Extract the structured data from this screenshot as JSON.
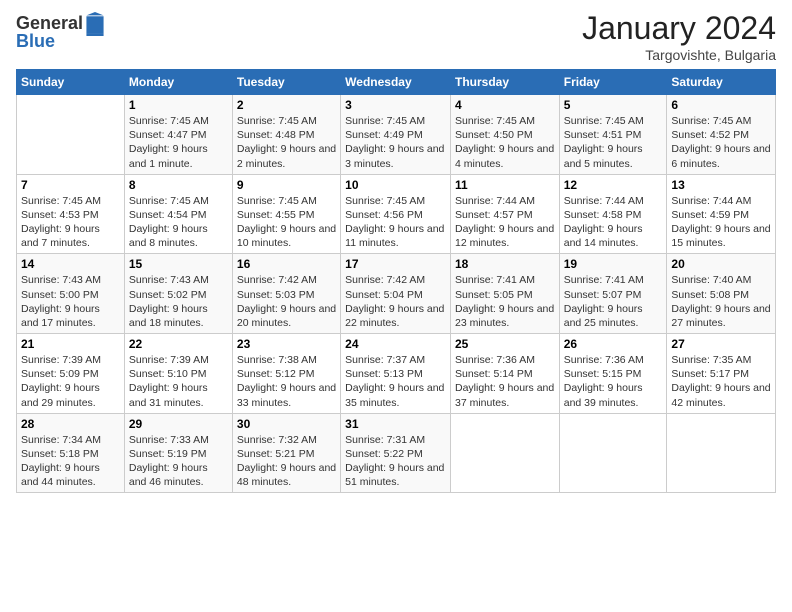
{
  "logo": {
    "general": "General",
    "blue": "Blue"
  },
  "header": {
    "title": "January 2024",
    "subtitle": "Targovishte, Bulgaria"
  },
  "days_of_week": [
    "Sunday",
    "Monday",
    "Tuesday",
    "Wednesday",
    "Thursday",
    "Friday",
    "Saturday"
  ],
  "weeks": [
    [
      {
        "day": "",
        "sunrise": "",
        "sunset": "",
        "daylight": ""
      },
      {
        "day": "1",
        "sunrise": "Sunrise: 7:45 AM",
        "sunset": "Sunset: 4:47 PM",
        "daylight": "Daylight: 9 hours and 1 minute."
      },
      {
        "day": "2",
        "sunrise": "Sunrise: 7:45 AM",
        "sunset": "Sunset: 4:48 PM",
        "daylight": "Daylight: 9 hours and 2 minutes."
      },
      {
        "day": "3",
        "sunrise": "Sunrise: 7:45 AM",
        "sunset": "Sunset: 4:49 PM",
        "daylight": "Daylight: 9 hours and 3 minutes."
      },
      {
        "day": "4",
        "sunrise": "Sunrise: 7:45 AM",
        "sunset": "Sunset: 4:50 PM",
        "daylight": "Daylight: 9 hours and 4 minutes."
      },
      {
        "day": "5",
        "sunrise": "Sunrise: 7:45 AM",
        "sunset": "Sunset: 4:51 PM",
        "daylight": "Daylight: 9 hours and 5 minutes."
      },
      {
        "day": "6",
        "sunrise": "Sunrise: 7:45 AM",
        "sunset": "Sunset: 4:52 PM",
        "daylight": "Daylight: 9 hours and 6 minutes."
      }
    ],
    [
      {
        "day": "7",
        "sunrise": "Sunrise: 7:45 AM",
        "sunset": "Sunset: 4:53 PM",
        "daylight": "Daylight: 9 hours and 7 minutes."
      },
      {
        "day": "8",
        "sunrise": "Sunrise: 7:45 AM",
        "sunset": "Sunset: 4:54 PM",
        "daylight": "Daylight: 9 hours and 8 minutes."
      },
      {
        "day": "9",
        "sunrise": "Sunrise: 7:45 AM",
        "sunset": "Sunset: 4:55 PM",
        "daylight": "Daylight: 9 hours and 10 minutes."
      },
      {
        "day": "10",
        "sunrise": "Sunrise: 7:45 AM",
        "sunset": "Sunset: 4:56 PM",
        "daylight": "Daylight: 9 hours and 11 minutes."
      },
      {
        "day": "11",
        "sunrise": "Sunrise: 7:44 AM",
        "sunset": "Sunset: 4:57 PM",
        "daylight": "Daylight: 9 hours and 12 minutes."
      },
      {
        "day": "12",
        "sunrise": "Sunrise: 7:44 AM",
        "sunset": "Sunset: 4:58 PM",
        "daylight": "Daylight: 9 hours and 14 minutes."
      },
      {
        "day": "13",
        "sunrise": "Sunrise: 7:44 AM",
        "sunset": "Sunset: 4:59 PM",
        "daylight": "Daylight: 9 hours and 15 minutes."
      }
    ],
    [
      {
        "day": "14",
        "sunrise": "Sunrise: 7:43 AM",
        "sunset": "Sunset: 5:00 PM",
        "daylight": "Daylight: 9 hours and 17 minutes."
      },
      {
        "day": "15",
        "sunrise": "Sunrise: 7:43 AM",
        "sunset": "Sunset: 5:02 PM",
        "daylight": "Daylight: 9 hours and 18 minutes."
      },
      {
        "day": "16",
        "sunrise": "Sunrise: 7:42 AM",
        "sunset": "Sunset: 5:03 PM",
        "daylight": "Daylight: 9 hours and 20 minutes."
      },
      {
        "day": "17",
        "sunrise": "Sunrise: 7:42 AM",
        "sunset": "Sunset: 5:04 PM",
        "daylight": "Daylight: 9 hours and 22 minutes."
      },
      {
        "day": "18",
        "sunrise": "Sunrise: 7:41 AM",
        "sunset": "Sunset: 5:05 PM",
        "daylight": "Daylight: 9 hours and 23 minutes."
      },
      {
        "day": "19",
        "sunrise": "Sunrise: 7:41 AM",
        "sunset": "Sunset: 5:07 PM",
        "daylight": "Daylight: 9 hours and 25 minutes."
      },
      {
        "day": "20",
        "sunrise": "Sunrise: 7:40 AM",
        "sunset": "Sunset: 5:08 PM",
        "daylight": "Daylight: 9 hours and 27 minutes."
      }
    ],
    [
      {
        "day": "21",
        "sunrise": "Sunrise: 7:39 AM",
        "sunset": "Sunset: 5:09 PM",
        "daylight": "Daylight: 9 hours and 29 minutes."
      },
      {
        "day": "22",
        "sunrise": "Sunrise: 7:39 AM",
        "sunset": "Sunset: 5:10 PM",
        "daylight": "Daylight: 9 hours and 31 minutes."
      },
      {
        "day": "23",
        "sunrise": "Sunrise: 7:38 AM",
        "sunset": "Sunset: 5:12 PM",
        "daylight": "Daylight: 9 hours and 33 minutes."
      },
      {
        "day": "24",
        "sunrise": "Sunrise: 7:37 AM",
        "sunset": "Sunset: 5:13 PM",
        "daylight": "Daylight: 9 hours and 35 minutes."
      },
      {
        "day": "25",
        "sunrise": "Sunrise: 7:36 AM",
        "sunset": "Sunset: 5:14 PM",
        "daylight": "Daylight: 9 hours and 37 minutes."
      },
      {
        "day": "26",
        "sunrise": "Sunrise: 7:36 AM",
        "sunset": "Sunset: 5:15 PM",
        "daylight": "Daylight: 9 hours and 39 minutes."
      },
      {
        "day": "27",
        "sunrise": "Sunrise: 7:35 AM",
        "sunset": "Sunset: 5:17 PM",
        "daylight": "Daylight: 9 hours and 42 minutes."
      }
    ],
    [
      {
        "day": "28",
        "sunrise": "Sunrise: 7:34 AM",
        "sunset": "Sunset: 5:18 PM",
        "daylight": "Daylight: 9 hours and 44 minutes."
      },
      {
        "day": "29",
        "sunrise": "Sunrise: 7:33 AM",
        "sunset": "Sunset: 5:19 PM",
        "daylight": "Daylight: 9 hours and 46 minutes."
      },
      {
        "day": "30",
        "sunrise": "Sunrise: 7:32 AM",
        "sunset": "Sunset: 5:21 PM",
        "daylight": "Daylight: 9 hours and 48 minutes."
      },
      {
        "day": "31",
        "sunrise": "Sunrise: 7:31 AM",
        "sunset": "Sunset: 5:22 PM",
        "daylight": "Daylight: 9 hours and 51 minutes."
      },
      {
        "day": "",
        "sunrise": "",
        "sunset": "",
        "daylight": ""
      },
      {
        "day": "",
        "sunrise": "",
        "sunset": "",
        "daylight": ""
      },
      {
        "day": "",
        "sunrise": "",
        "sunset": "",
        "daylight": ""
      }
    ]
  ]
}
